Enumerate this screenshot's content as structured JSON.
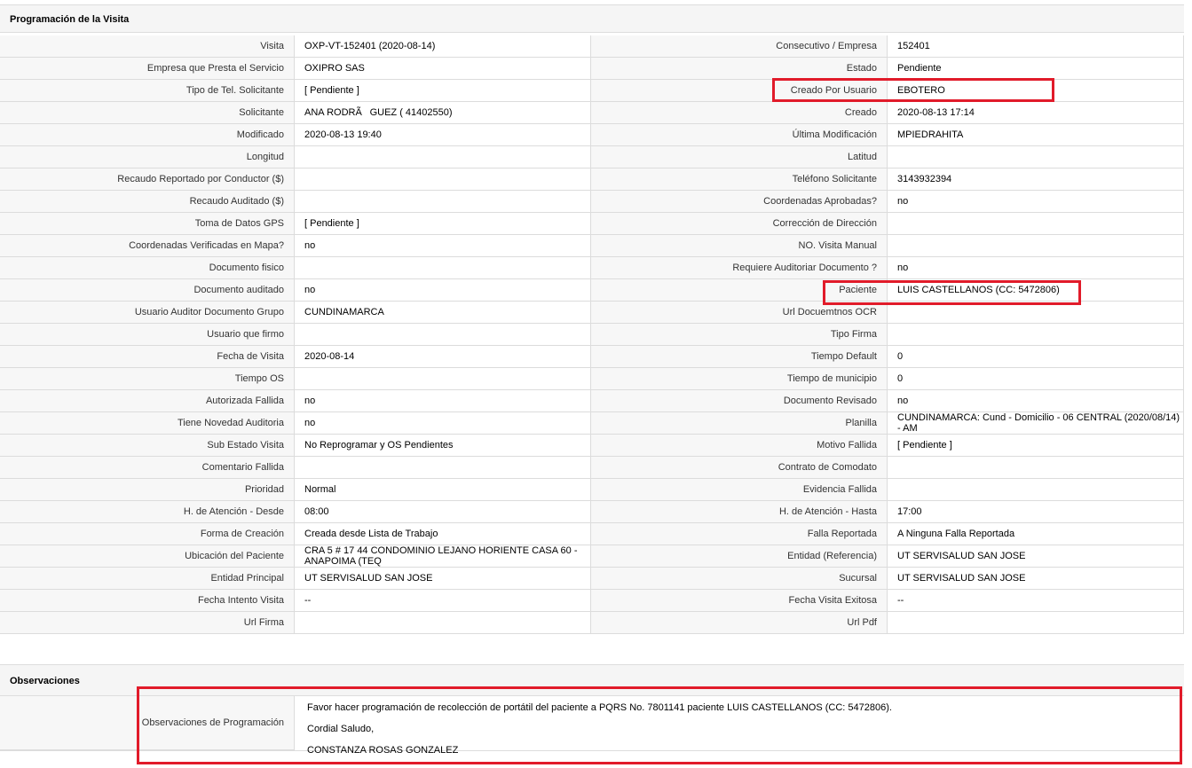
{
  "section1_title": "Programación de la Visita",
  "section2_title": "Observaciones",
  "rows": [
    [
      "Visita",
      "OXP-VT-152401 (2020-08-14)",
      "Consecutivo / Empresa",
      "152401"
    ],
    [
      "Empresa que Presta el Servicio",
      "OXIPRO SAS",
      "Estado",
      "Pendiente"
    ],
    [
      "Tipo de Tel. Solicitante",
      "[ Pendiente ]",
      "Creado Por Usuario",
      "EBOTERO"
    ],
    [
      "Solicitante",
      "ANA RODRÃGUEZ ( 41402550)",
      "Creado",
      "2020-08-13 17:14"
    ],
    [
      "Modificado",
      "2020-08-13 19:40",
      "Última Modificación",
      " MPIEDRAHITA"
    ],
    [
      "Longitud",
      "",
      "Latitud",
      ""
    ],
    [
      "Recaudo Reportado por Conductor ($)",
      "",
      "Teléfono Solicitante",
      "3143932394"
    ],
    [
      "Recaudo Auditado ($)",
      "",
      "Coordenadas Aprobadas?",
      " no"
    ],
    [
      "Toma de Datos GPS",
      "[ Pendiente ]",
      "Corrección de Dirección",
      ""
    ],
    [
      "Coordenadas Verificadas en Mapa?",
      " no",
      "NO. Visita Manual",
      ""
    ],
    [
      "Documento fisico",
      "",
      "Requiere Auditoriar Documento ?",
      " no"
    ],
    [
      "Documento auditado",
      " no",
      "Paciente",
      "LUIS CASTELLANOS (CC: 5472806)"
    ],
    [
      "Usuario Auditor Documento Grupo",
      "CUNDINAMARCA",
      "Url Docuemtnos OCR",
      ""
    ],
    [
      "Usuario que firmo",
      "",
      "Tipo Firma",
      ""
    ],
    [
      "Fecha de Visita",
      " 2020-08-14",
      "Tiempo Default",
      "0"
    ],
    [
      "Tiempo OS",
      "",
      "Tiempo de municipio",
      "0"
    ],
    [
      "Autorizada Fallida",
      " no",
      "Documento Revisado",
      " no"
    ],
    [
      "Tiene Novedad Auditoria",
      " no",
      "Planilla",
      "CUNDINAMARCA: Cund - Domicilio - 06 CENTRAL (2020/08/14) - AM"
    ],
    [
      "Sub Estado Visita",
      "No Reprogramar y OS Pendientes",
      "Motivo Fallida",
      "[ Pendiente ]"
    ],
    [
      "Comentario Fallida",
      "",
      "Contrato de Comodato",
      ""
    ],
    [
      "Prioridad",
      "Normal",
      "Evidencia Fallida",
      ""
    ],
    [
      "H. de Atención - Desde",
      "08:00",
      "H. de Atención - Hasta",
      "17:00"
    ],
    [
      "Forma de Creación",
      "Creada desde Lista de Trabajo",
      "Falla Reportada",
      "A Ninguna Falla Reportada"
    ],
    [
      "Ubicación del Paciente",
      "CRA 5 # 17 44 CONDOMINIO LEJANO HORIENTE CASA 60 - ANAPOIMA (TEQ",
      "Entidad (Referencia)",
      "UT SERVISALUD SAN JOSE"
    ],
    [
      "Entidad Principal",
      "UT SERVISALUD SAN JOSE",
      "Sucursal",
      "UT SERVISALUD SAN JOSE"
    ],
    [
      "Fecha Intento Visita",
      " --",
      "Fecha Visita Exitosa",
      " --"
    ],
    [
      "Url Firma",
      "",
      "Url Pdf",
      ""
    ]
  ],
  "observaciones": {
    "label": "Observaciones de Programación",
    "lines": [
      "Favor hacer programación de recolección de portátil del paciente a PQRS No. 7801141 paciente LUIS CASTELLANOS (CC: 5472806).",
      "Cordial Saludo,",
      "CONSTANZA ROSAS GONZALEZ"
    ]
  },
  "highlight_color": "#e11b2a"
}
